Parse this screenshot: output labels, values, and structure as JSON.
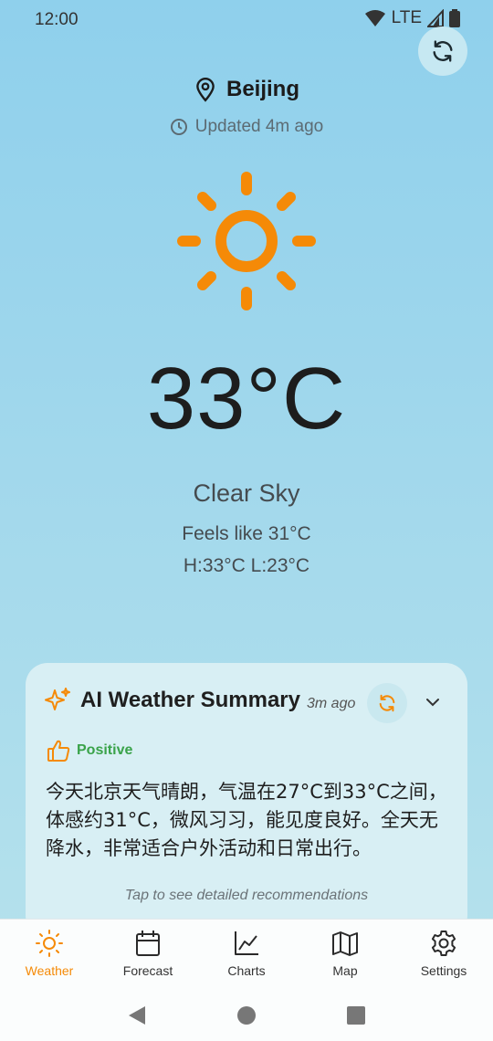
{
  "status_bar": {
    "time": "12:00",
    "network": "LTE"
  },
  "location": {
    "city": "Beijing",
    "updated": "Updated 4m ago"
  },
  "current": {
    "temperature": "33°C",
    "condition": "Clear Sky",
    "feels_like": "Feels like 31°C",
    "high_low": "H:33°C L:23°C",
    "icon": "sun-icon"
  },
  "ai_summary": {
    "title": "AI Weather Summary",
    "time": "3m ago",
    "sentiment": "Positive",
    "text": "今天北京天气晴朗，气温在27°C到33°C之间，体感约31°C，微风习习，能见度良好。全天无降水，非常适合户外活动和日常出行。",
    "hint": "Tap to see detailed recommendations"
  },
  "nav": {
    "items": [
      {
        "label": "Weather",
        "icon": "sun-icon",
        "active": true
      },
      {
        "label": "Forecast",
        "icon": "calendar-icon"
      },
      {
        "label": "Charts",
        "icon": "chart-icon"
      },
      {
        "label": "Map",
        "icon": "map-icon"
      },
      {
        "label": "Settings",
        "icon": "gear-icon"
      }
    ]
  },
  "colors": {
    "accent": "#f58a07",
    "positive": "#3aa34a",
    "sky_top": "#8fd0ec",
    "card_bg": "#d8eff4"
  }
}
